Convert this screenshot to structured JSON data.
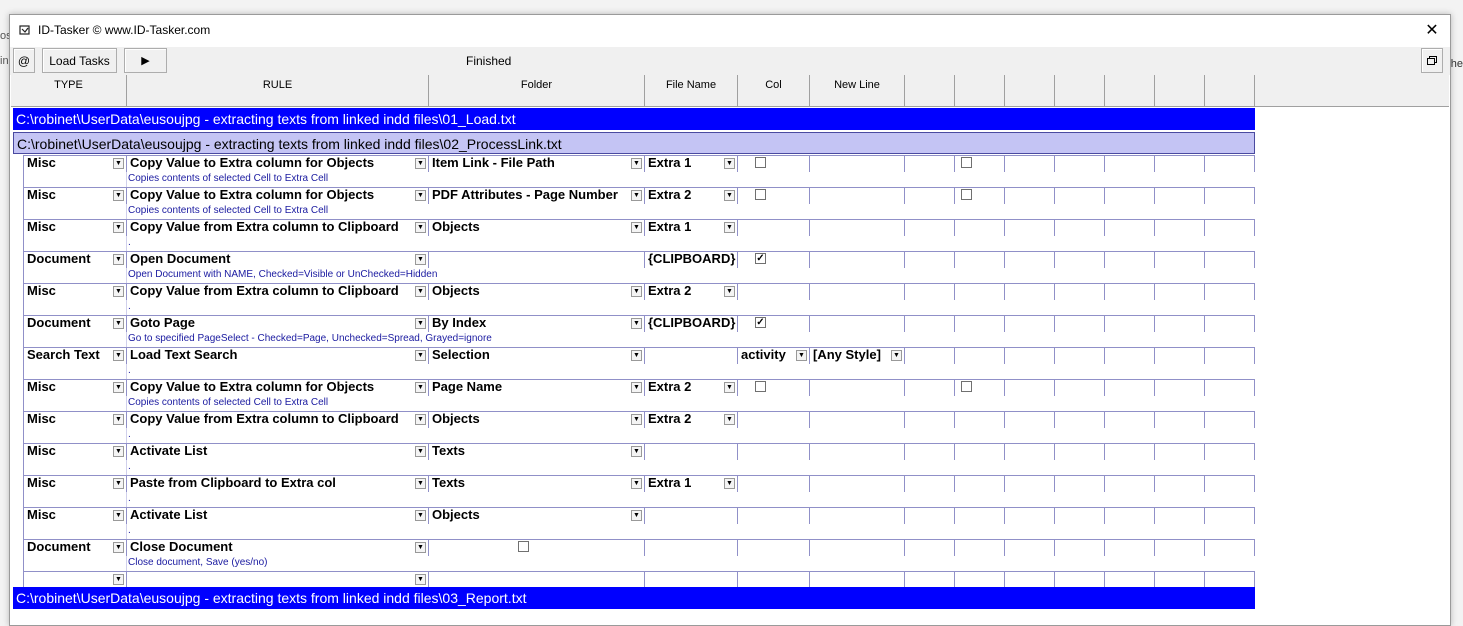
{
  "background": {
    "left_mark": "os",
    "left_mark2": "in",
    "right_mark": "he"
  },
  "window": {
    "title": "ID-Tasker  © www.ID-Tasker.com"
  },
  "toolbar": {
    "at_label": "@",
    "load_label": "Load Tasks",
    "play_label": "▶",
    "status": "Finished",
    "restore_label": "🗗"
  },
  "columns": [
    "TYPE",
    "RULE",
    "Folder",
    "File Name",
    "Col",
    "New Line",
    "",
    "",
    "",
    "",
    "",
    "",
    ""
  ],
  "files": {
    "f1": "C:\\robinet\\UserData\\eusoujpg - extracting texts from linked indd files\\01_Load.txt",
    "f2": "C:\\robinet\\UserData\\eusoujpg - extracting texts from linked indd files\\02_ProcessLink.txt",
    "f3": "C:\\robinet\\UserData\\eusoujpg - extracting texts from linked indd files\\03_Report.txt"
  },
  "rows": [
    {
      "type": "Misc",
      "rule": "Copy Value to Extra column for Objects",
      "folder": " Item Link - File Path",
      "file": "Extra 1",
      "desc": "Copies contents of selected Cell to Extra Cell"
    },
    {
      "type": "Misc",
      "rule": "Copy Value to Extra column for Objects",
      "folder": "PDF Attributes - Page Number",
      "file": "Extra 2",
      "desc": "Copies contents of selected Cell to Extra Cell"
    },
    {
      "type": "Misc",
      "rule": "Copy Value from Extra column to Clipboard",
      "folder": "Objects",
      "file": "Extra 1",
      "desc": "."
    },
    {
      "type": "Document",
      "rule": "Open Document",
      "folder": "",
      "file": "{CLIPBOARD}",
      "desc": "Open Document with NAME, Checked=Visible or UnChecked=Hidden"
    },
    {
      "type": "Misc",
      "rule": "Copy Value from Extra column to Clipboard",
      "folder": "Objects",
      "file": "Extra 2",
      "desc": "."
    },
    {
      "type": "Document",
      "rule": "Goto Page",
      "folder": "By Index",
      "file": "{CLIPBOARD}",
      "desc": "Go to specified PageSelect - Checked=Page, Unchecked=Spread, Grayed=ignore"
    },
    {
      "type": "Search Text",
      "rule": "Load Text Search",
      "folder": "Selection",
      "file": "",
      "col": "activity",
      "newline": "[Any Style]",
      "desc": "."
    },
    {
      "type": "Misc",
      "rule": "Copy Value to Extra column for Objects",
      "folder": "Page Name",
      "file": "Extra 2",
      "desc": "Copies contents of selected Cell to Extra Cell"
    },
    {
      "type": "Misc",
      "rule": "Copy Value from Extra column to Clipboard",
      "folder": "Objects",
      "file": "Extra 2",
      "desc": "."
    },
    {
      "type": "Misc",
      "rule": "Activate List",
      "folder": "Texts",
      "file": "",
      "desc": "."
    },
    {
      "type": "Misc",
      "rule": "Paste from Clipboard to Extra col",
      "folder": "Texts",
      "file": "Extra 1",
      "desc": "."
    },
    {
      "type": "Misc",
      "rule": "Activate List",
      "folder": "Objects",
      "file": "",
      "desc": "."
    },
    {
      "type": "Document",
      "rule": "Close Document",
      "folder": "",
      "file": "",
      "desc": "Close document, Save (yes/no)"
    }
  ],
  "check_marks": {
    "checked": "✓"
  }
}
